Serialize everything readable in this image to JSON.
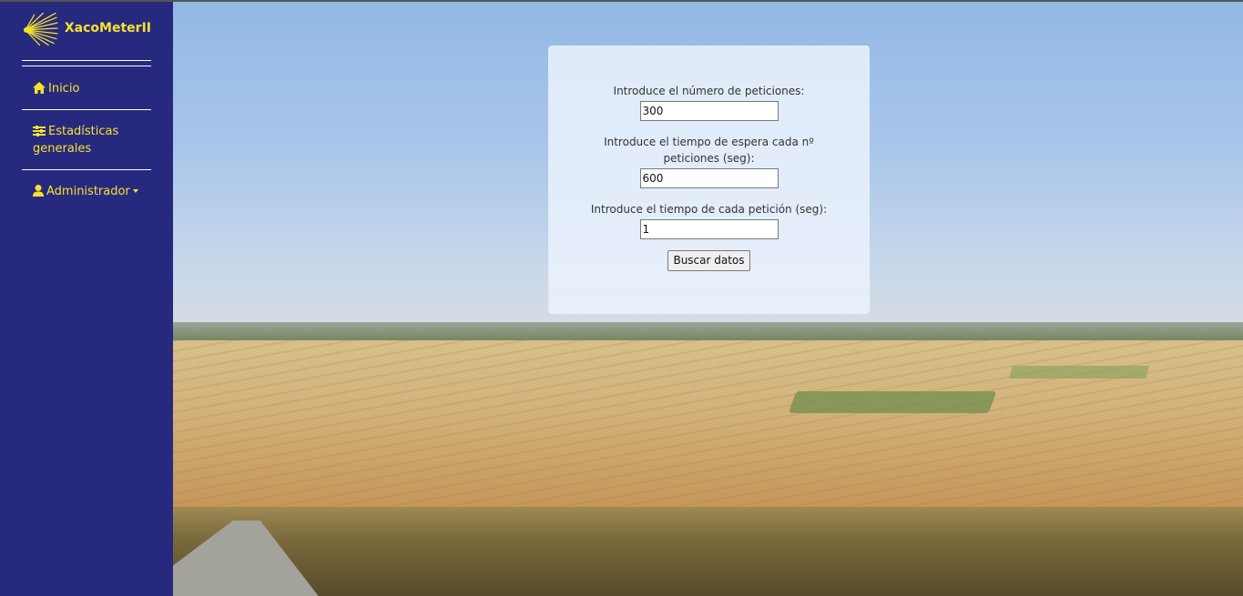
{
  "app": {
    "name": "XacoMeterII"
  },
  "sidebar": {
    "items": [
      {
        "label": "Inicio",
        "icon": "home-icon"
      },
      {
        "label": "Estadísticas generales",
        "icon": "sliders-icon"
      },
      {
        "label": "Administrador",
        "icon": "user-icon",
        "has_dropdown": true
      }
    ]
  },
  "form": {
    "requests_label": "Introduce el número de peticiones:",
    "requests_value": "300",
    "wait_label": "Introduce el tiempo de espera cada nº peticiones (seg):",
    "wait_value": "600",
    "request_time_label": "Introduce el tiempo de cada petición (seg):",
    "request_time_value": "1",
    "submit_label": "Buscar datos"
  },
  "colors": {
    "sidebar_bg": "#27297f",
    "accent": "#f5e32b"
  }
}
